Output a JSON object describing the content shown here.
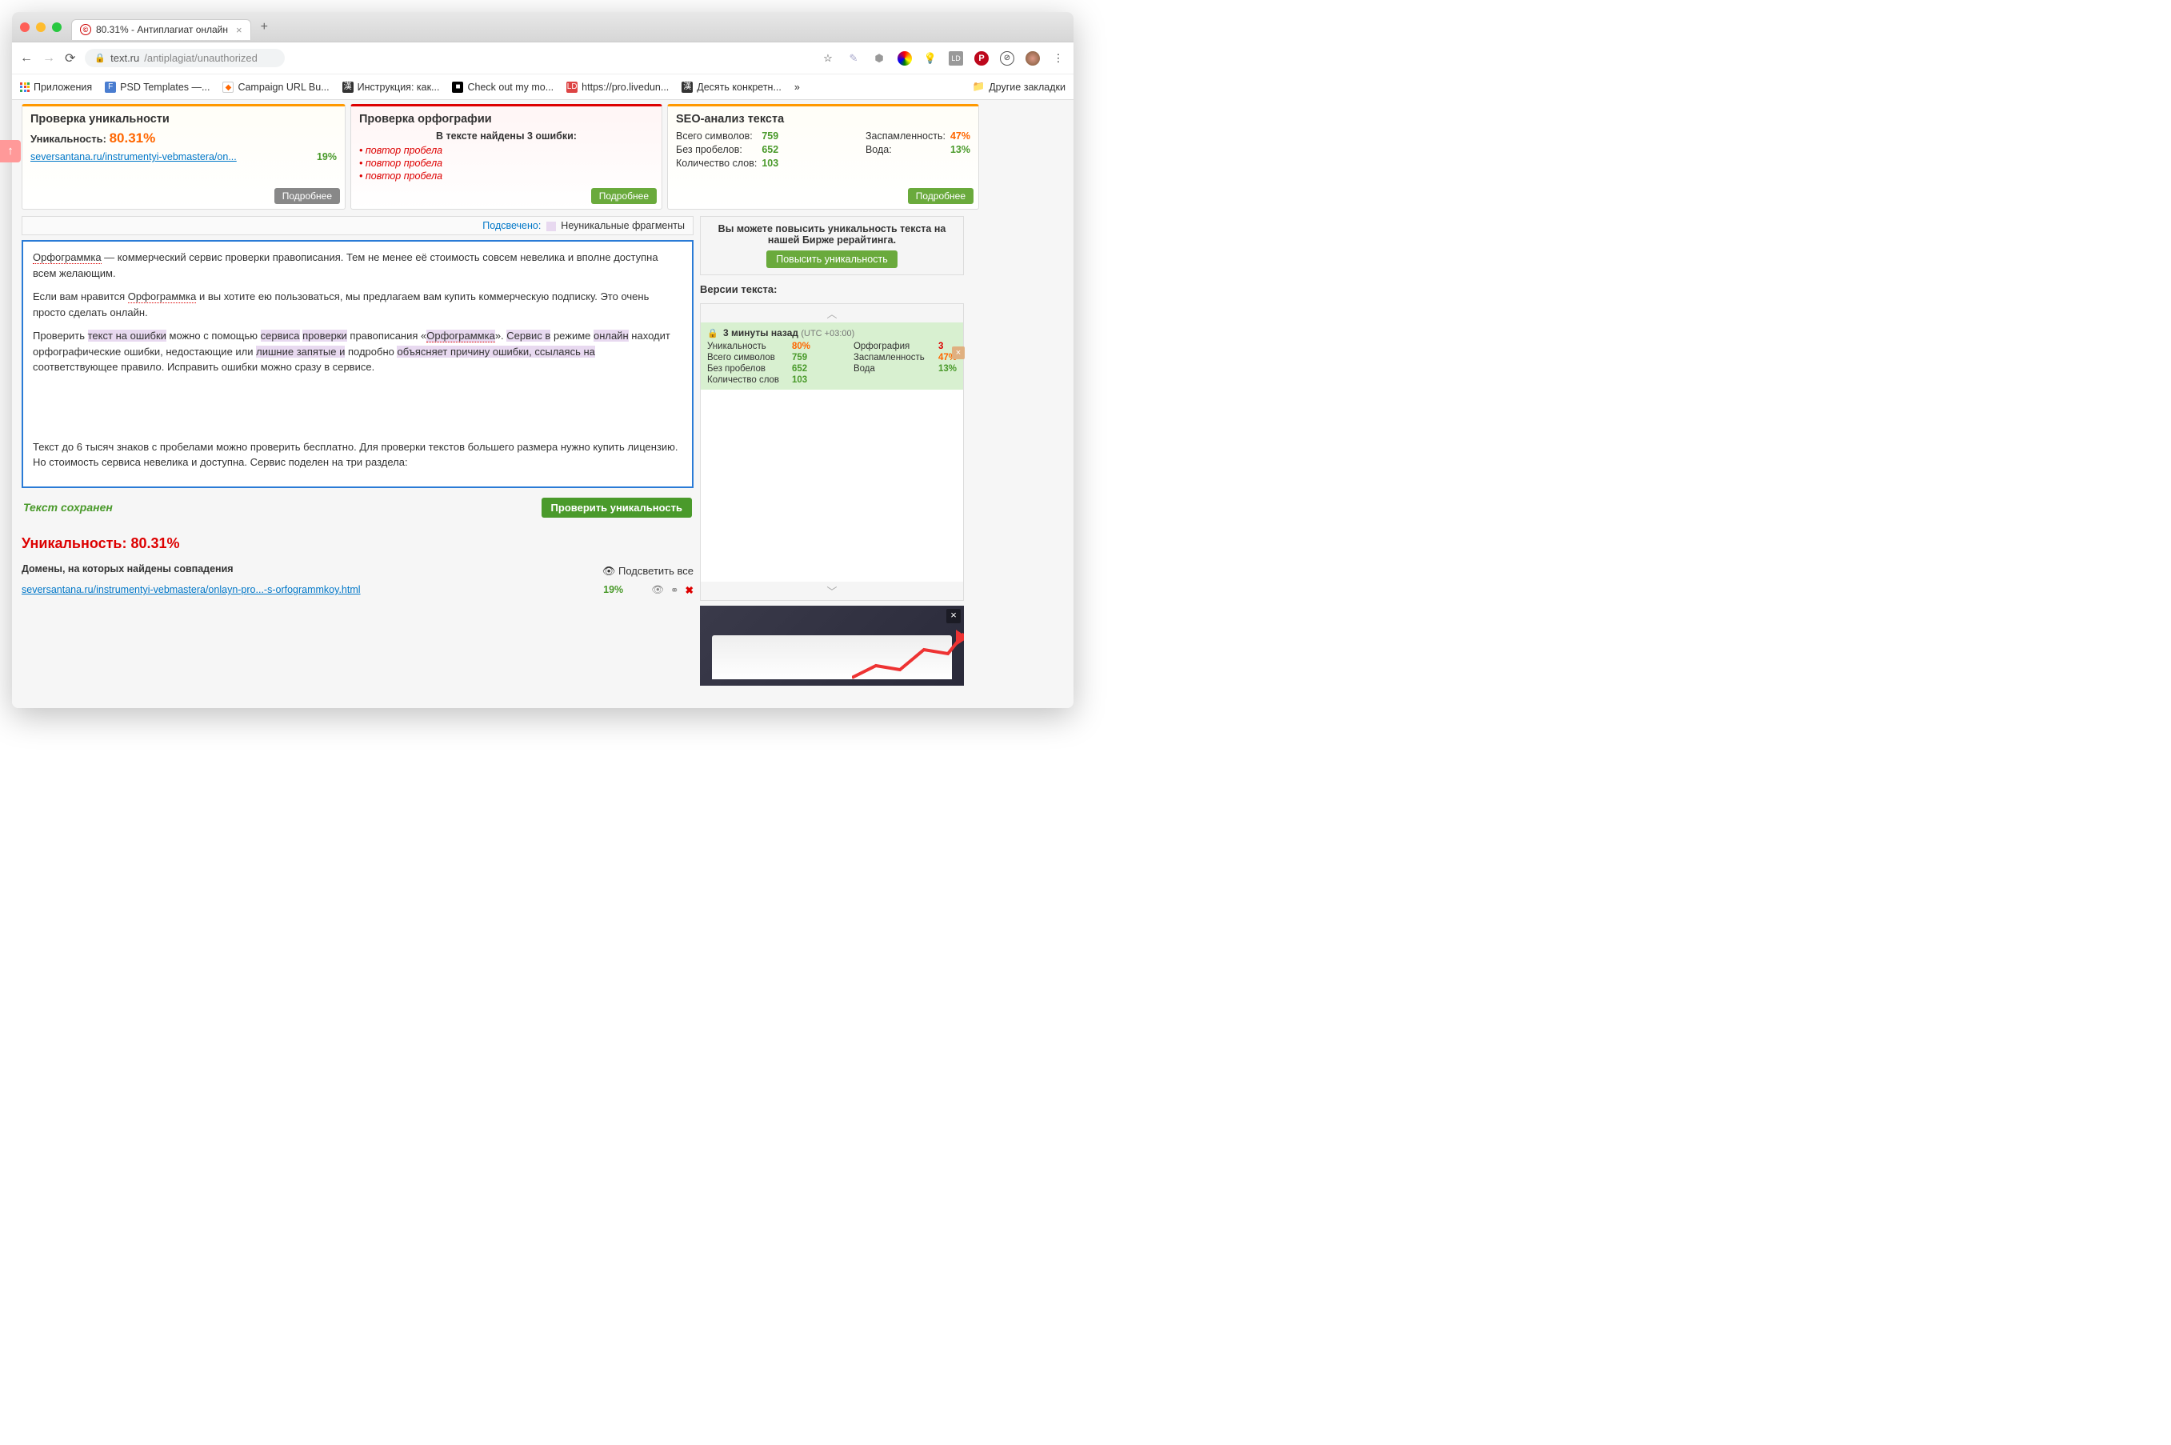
{
  "browser": {
    "tab_title": "80.31% - Антиплагиат онлайн",
    "url_host": "text.ru",
    "url_path": "/antiplagiat/unauthorized",
    "new_tab": "+",
    "bookmarks": {
      "apps": "Приложения",
      "items": [
        {
          "icon": "F",
          "bg": "#4a7dd0",
          "label": "PSD Templates —..."
        },
        {
          "icon": "◆",
          "bg": "#fff",
          "label": "Campaign URL Bu..."
        },
        {
          "icon": "漢",
          "bg": "#333",
          "label": "Инструкция: как..."
        },
        {
          "icon": "■",
          "bg": "#000",
          "label": "Check out my mo..."
        },
        {
          "icon": "LD",
          "bg": "#d44",
          "label": "https://pro.livedun..."
        },
        {
          "icon": "漢",
          "bg": "#333",
          "label": "Десять конкретн..."
        }
      ],
      "more": "»",
      "other": "Другие закладки"
    }
  },
  "cards": {
    "uniqueness": {
      "title": "Проверка уникальности",
      "label": "Уникальность:",
      "value": "80.31%",
      "link": "seversantana.ru/instrumentyi-vebmastera/on...",
      "pct": "19%",
      "button": "Подробнее"
    },
    "orthography": {
      "title": "Проверка орфографии",
      "subtitle": "В тексте найдены 3 ошибки:",
      "errors": [
        "повтор пробела",
        "повтор пробела",
        "повтор пробела"
      ],
      "button": "Подробнее"
    },
    "seo": {
      "title": "SEO-анализ текста",
      "left": [
        {
          "label": "Всего символов:",
          "value": "759",
          "cls": "green"
        },
        {
          "label": "Без пробелов:",
          "value": "652",
          "cls": "green"
        },
        {
          "label": "Количество слов:",
          "value": "103",
          "cls": "green"
        }
      ],
      "right": [
        {
          "label": "Заспамленность:",
          "value": "47%",
          "cls": "orange"
        },
        {
          "label": "Вода:",
          "value": "13%",
          "cls": "green"
        }
      ],
      "button": "Подробнее"
    }
  },
  "editor": {
    "highlight_label": "Подсвечено:",
    "highlight_type": "Неуникальные фрагменты",
    "text": {
      "p1a": "Орфограммка",
      "p1b": " — коммерческий сервис проверки правописания. Тем не менее её стоимость совсем невелика и вполне доступна всем желающим.",
      "p2a": "Если вам нравится ",
      "p2b": "Орфограммка",
      "p2c": " и вы хотите ею пользоваться, мы предлагаем вам купить коммерческую подписку. Это очень просто сделать онлайн.",
      "p3": "Проверить текст на ошибки можно с помощью сервиса  проверки правописания «Орфограммка».  Сервис в режиме онлайн  находит орфографические ошибки, недостающие или лишние запятые и подробно объясняет причину ошибки, ссылаясь на соответствующее правило. Исправить ошибки можно сразу в сервисе.",
      "p4": "Текст до 6 тысяч знаков с пробелами можно проверить бесплатно. Для проверки текстов большего размера нужно купить лицензию. Но стоимость сервиса невелика и доступна. Сервис поделен на три раздела:"
    },
    "saved": "Текст сохранен",
    "check_button": "Проверить уникальность"
  },
  "results": {
    "title": "Уникальность: 80.31%",
    "domains_title": "Домены, на которых найдены совпадения",
    "highlight_all": "Подсветить все",
    "row": {
      "link": "seversantana.ru/instrumentyi-vebmastera/onlayn-pro...-s-orfogrammkoy.html",
      "pct": "19%"
    }
  },
  "sidebar": {
    "boost": {
      "text": "Вы можете повысить уникальность текста на нашей Бирже рерайтинга.",
      "button": "Повысить уникальность"
    },
    "versions": {
      "title": "Версии текста:",
      "item": {
        "time": "3 минуты назад",
        "tz": "(UTC +03:00)",
        "left": [
          {
            "label": "Уникальность",
            "value": "80%",
            "cls": "orange"
          },
          {
            "label": "Всего символов",
            "value": "759",
            "cls": "green"
          },
          {
            "label": "Без пробелов",
            "value": "652",
            "cls": "green"
          },
          {
            "label": "Количество слов",
            "value": "103",
            "cls": "green"
          }
        ],
        "right": [
          {
            "label": "Орфография",
            "value": "3",
            "cls": "red"
          },
          {
            "label": "Заспамленность",
            "value": "47%",
            "cls": "orange"
          },
          {
            "label": "Вода",
            "value": "13%",
            "cls": "green"
          }
        ]
      }
    }
  }
}
